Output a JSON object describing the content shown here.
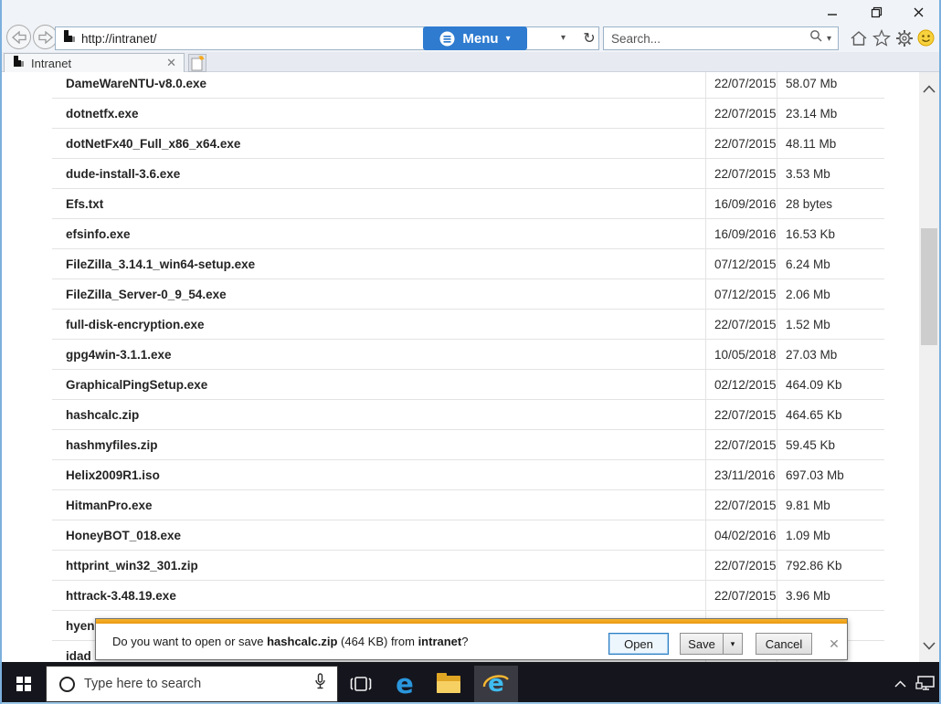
{
  "browser": {
    "url": "http://intranet/",
    "menu_label": "Menu",
    "search_placeholder": "Search...",
    "tab_title": "Intranet"
  },
  "icons": {
    "minimize_glyph": "–",
    "close_glyph": "✕",
    "refresh_glyph": "↻",
    "caret_glyph": "▾",
    "tab_close_glyph": "✕",
    "dialog_close_glyph": "✕",
    "edge_glyph": "e",
    "ie_glyph": "e"
  },
  "file_table": {
    "rows": [
      {
        "name": "DameWareNTU-v8.0.exe",
        "date": "22/07/2015",
        "size": "58.07 Mb"
      },
      {
        "name": "dotnetfx.exe",
        "date": "22/07/2015",
        "size": "23.14 Mb"
      },
      {
        "name": "dotNetFx40_Full_x86_x64.exe",
        "date": "22/07/2015",
        "size": "48.11 Mb"
      },
      {
        "name": "dude-install-3.6.exe",
        "date": "22/07/2015",
        "size": "3.53 Mb"
      },
      {
        "name": "Efs.txt",
        "date": "16/09/2016",
        "size": "28 bytes"
      },
      {
        "name": "efsinfo.exe",
        "date": "16/09/2016",
        "size": "16.53 Kb"
      },
      {
        "name": "FileZilla_3.14.1_win64-setup.exe",
        "date": "07/12/2015",
        "size": "6.24 Mb"
      },
      {
        "name": "FileZilla_Server-0_9_54.exe",
        "date": "07/12/2015",
        "size": "2.06 Mb"
      },
      {
        "name": "full-disk-encryption.exe",
        "date": "22/07/2015",
        "size": "1.52 Mb"
      },
      {
        "name": "gpg4win-3.1.1.exe",
        "date": "10/05/2018",
        "size": "27.03 Mb"
      },
      {
        "name": "GraphicalPingSetup.exe",
        "date": "02/12/2015",
        "size": "464.09 Kb"
      },
      {
        "name": "hashcalc.zip",
        "date": "22/07/2015",
        "size": "464.65 Kb"
      },
      {
        "name": "hashmyfiles.zip",
        "date": "22/07/2015",
        "size": "59.45 Kb"
      },
      {
        "name": "Helix2009R1.iso",
        "date": "23/11/2016",
        "size": "697.03 Mb"
      },
      {
        "name": "HitmanPro.exe",
        "date": "22/07/2015",
        "size": "9.81 Mb"
      },
      {
        "name": "HoneyBOT_018.exe",
        "date": "04/02/2016",
        "size": "1.09 Mb"
      },
      {
        "name": "httprint_win32_301.zip",
        "date": "22/07/2015",
        "size": "792.86 Kb"
      },
      {
        "name": "httrack-3.48.19.exe",
        "date": "22/07/2015",
        "size": "3.96 Mb"
      },
      {
        "name": "hyen",
        "date": "",
        "size": ""
      },
      {
        "name": "idad",
        "date": "",
        "size": ""
      }
    ]
  },
  "download_bar": {
    "message_prefix": "Do you want to open or save ",
    "file_name": "hashcalc.zip",
    "message_middle": " (464 KB) from ",
    "host": "intranet",
    "message_suffix": "?",
    "open_label": "Open",
    "save_label": "Save",
    "cancel_label": "Cancel"
  },
  "taskbar": {
    "search_placeholder": "Type here to search"
  },
  "colors": {
    "menu_button_blue": "#2e7bd0",
    "notification_gold": "#eda01f",
    "taskbar_dark": "#15151e",
    "ie_blue": "#3fbcf0",
    "edge_blue": "#2a97dd",
    "folder_yellow": "#f7d063",
    "smiley_yellow": "#f7d23e"
  }
}
